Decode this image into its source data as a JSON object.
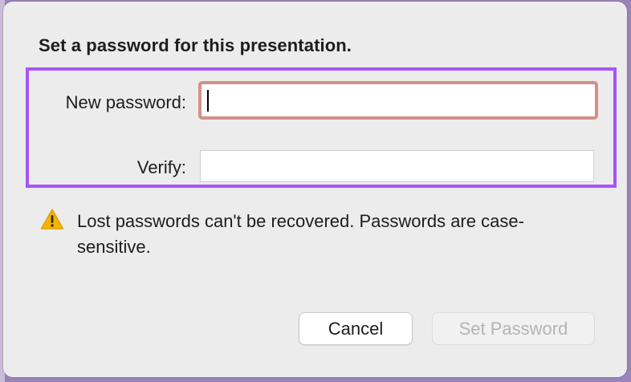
{
  "dialog": {
    "title": "Set a password for this presentation.",
    "new_password_label": "New password:",
    "new_password_value": "",
    "verify_label": "Verify:",
    "verify_value": "",
    "warning_text": "Lost passwords can't be recovered. Passwords are case-sensitive.",
    "warning_icon": "warning-triangle-icon",
    "cancel_label": "Cancel",
    "set_password_label": "Set Password",
    "set_password_enabled": false
  },
  "colors": {
    "highlight": "#a855f7",
    "focus_ring": "#d49086",
    "warning": "#f5b400"
  }
}
